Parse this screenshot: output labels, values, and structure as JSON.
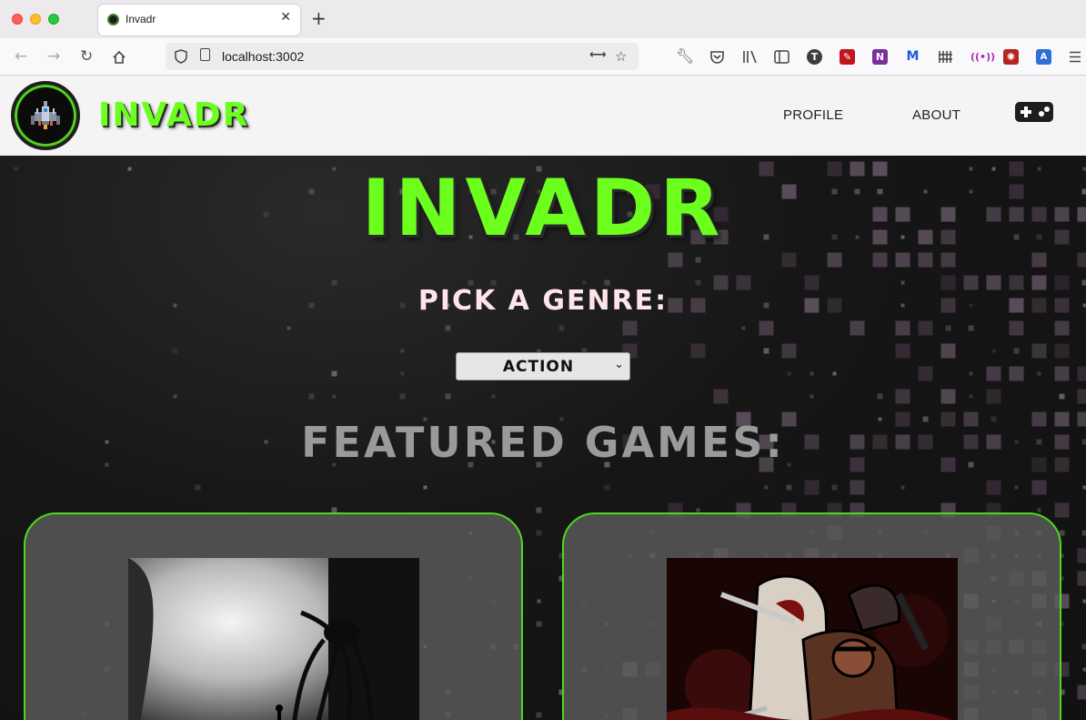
{
  "browser": {
    "tab_title": "Invadr",
    "tab_close": "✕",
    "new_tab": "+",
    "url": "localhost:3002"
  },
  "header": {
    "brand": "INVADR",
    "nav": [
      {
        "label": "PROFILE"
      },
      {
        "label": "ABOUT"
      }
    ]
  },
  "hero": {
    "title": "INVADR",
    "genre_label": "PICK A GENRE:",
    "genre_selected": "ACTION",
    "featured_heading": "FEATURED GAMES:"
  },
  "games": [
    {
      "icon": "limbo-cover-art"
    },
    {
      "icon": "darkest-dungeon-cover-art"
    }
  ],
  "colors": {
    "accent_green": "#6cff1e",
    "card_border": "#4ed81f",
    "genre_label": "#ffe4ea",
    "background": "#151515"
  }
}
